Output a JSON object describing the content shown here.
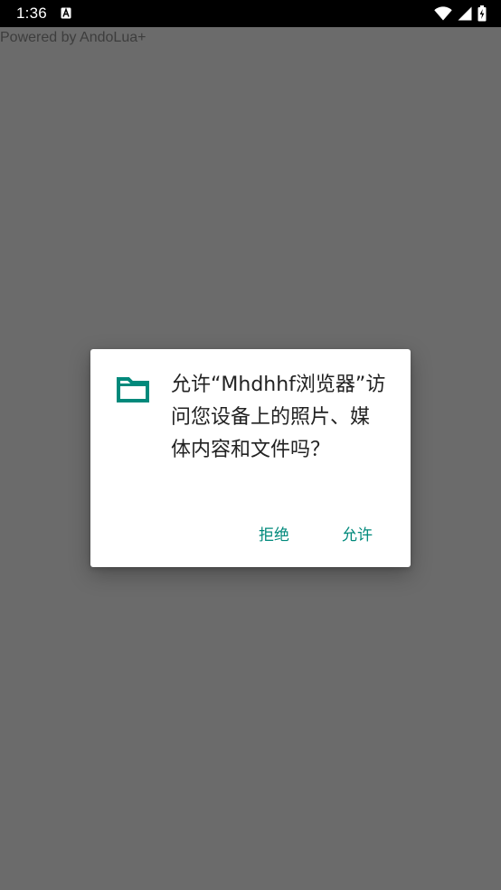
{
  "status_bar": {
    "time": "1:36",
    "notification_icon": "a-letter-notification-icon",
    "wifi_icon": "wifi-icon",
    "signal_icon": "cellular-signal-icon",
    "battery_icon": "battery-icon"
  },
  "app": {
    "powered_text": "Powered by AndoLua+"
  },
  "dialog": {
    "icon": "folder-icon",
    "message": "允许“Mhdhhf浏览器”访问您设备上的照片、媒体内容和文件吗？",
    "deny_label": "拒绝",
    "allow_label": "允许"
  },
  "colors": {
    "accent": "#00897b",
    "scrim": "#6b6b6b",
    "status_bar": "#000000"
  }
}
